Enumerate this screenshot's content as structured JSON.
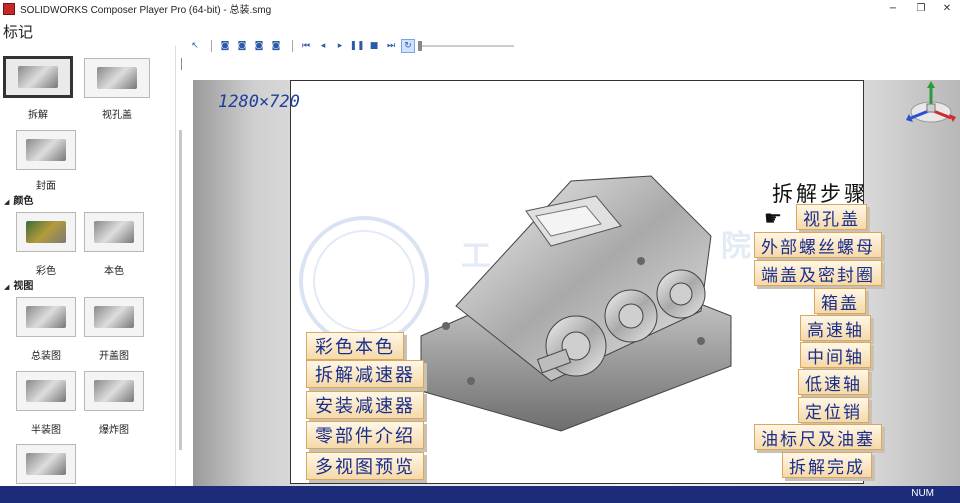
{
  "window": {
    "title": "SOLIDWORKS Composer Player Pro (64-bit) - 总装.smg",
    "minimize_glyph": "−",
    "restore_glyph": "❐",
    "close_glyph": "✕"
  },
  "panel": {
    "title": "标记",
    "thumbs": [
      {
        "label": "拆解"
      },
      {
        "label": "视孔盖"
      },
      {
        "label": "封面"
      }
    ],
    "groups": [
      {
        "name": "颜色",
        "items": [
          {
            "label": "彩色"
          },
          {
            "label": "本色"
          }
        ]
      },
      {
        "name": "视图",
        "items": [
          {
            "label": "总装图"
          },
          {
            "label": "开盖图"
          },
          {
            "label": "半装图"
          },
          {
            "label": "爆炸图"
          }
        ]
      }
    ]
  },
  "toolbar": {
    "icons": [
      "cursor-icon",
      "camera-icon",
      "camera-icon",
      "camera-icon",
      "camera-icon",
      "first-icon",
      "prev-icon",
      "play-icon",
      "pause-icon",
      "stop-icon",
      "last-icon",
      "loop-icon"
    ]
  },
  "canvas": {
    "dimension_note": "1280×720",
    "left_buttons": [
      "彩色本色",
      "拆解减速器",
      "安装减速器",
      "零部件介绍",
      "多视图预览"
    ],
    "steps_title": "拆解步骤",
    "right_buttons": [
      "视孔盖",
      "外部螺丝螺母",
      "端盖及密封圈",
      "箱盖",
      "高速轴",
      "中间轴",
      "低速轴",
      "定位销",
      "油标尺及油塞",
      "拆解完成"
    ]
  },
  "status": {
    "num": "NUM"
  },
  "colors": {
    "status_bar": "#1c2c78",
    "button_text": "#1a2e8c",
    "button_bg": "#f5d9a8"
  }
}
